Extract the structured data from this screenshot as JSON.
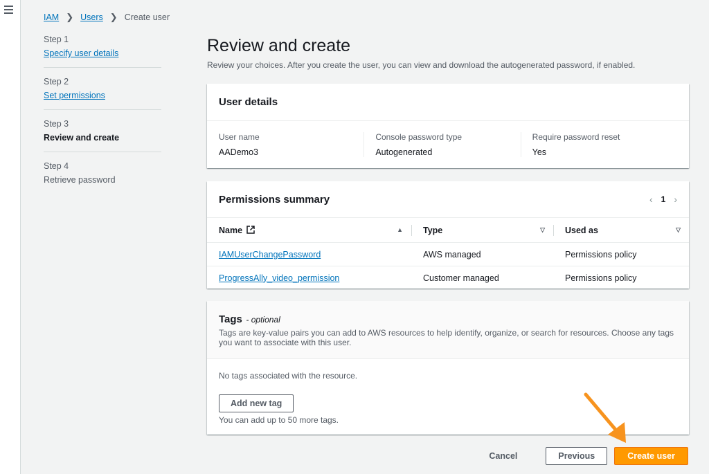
{
  "breadcrumb": {
    "items": [
      "IAM",
      "Users"
    ],
    "current": "Create user"
  },
  "steps": [
    {
      "num": "Step 1",
      "title": "Specify user details"
    },
    {
      "num": "Step 2",
      "title": "Set permissions"
    },
    {
      "num": "Step 3",
      "title": "Review and create"
    },
    {
      "num": "Step 4",
      "title": "Retrieve password"
    }
  ],
  "page": {
    "title": "Review and create",
    "description": "Review your choices. After you create the user, you can view and download the autogenerated password, if enabled."
  },
  "user_details": {
    "title": "User details",
    "fields": [
      {
        "label": "User name",
        "value": "AADemo3"
      },
      {
        "label": "Console password type",
        "value": "Autogenerated"
      },
      {
        "label": "Require password reset",
        "value": "Yes"
      }
    ]
  },
  "permissions": {
    "title": "Permissions summary",
    "page": "1",
    "columns": [
      "Name",
      "Type",
      "Used as"
    ],
    "rows": [
      {
        "name": "IAMUserChangePassword",
        "type": "AWS managed",
        "used_as": "Permissions policy"
      },
      {
        "name": "ProgressAlly_video_permission",
        "type": "Customer managed",
        "used_as": "Permissions policy"
      }
    ]
  },
  "tags": {
    "title": "Tags",
    "optional": "- optional",
    "description": "Tags are key-value pairs you can add to AWS resources to help identify, organize, or search for resources. Choose any tags you want to associate with this user.",
    "empty": "No tags associated with the resource.",
    "add_button": "Add new tag",
    "limit": "You can add up to 50 more tags."
  },
  "actions": {
    "cancel": "Cancel",
    "previous": "Previous",
    "create": "Create user"
  },
  "colors": {
    "primary": "#ff9900",
    "link": "#0073bb",
    "arrow": "#f7931e"
  },
  "icons": {
    "menu": "hamburger-icon",
    "external": "external-link-icon",
    "sort": "sort-icon"
  }
}
